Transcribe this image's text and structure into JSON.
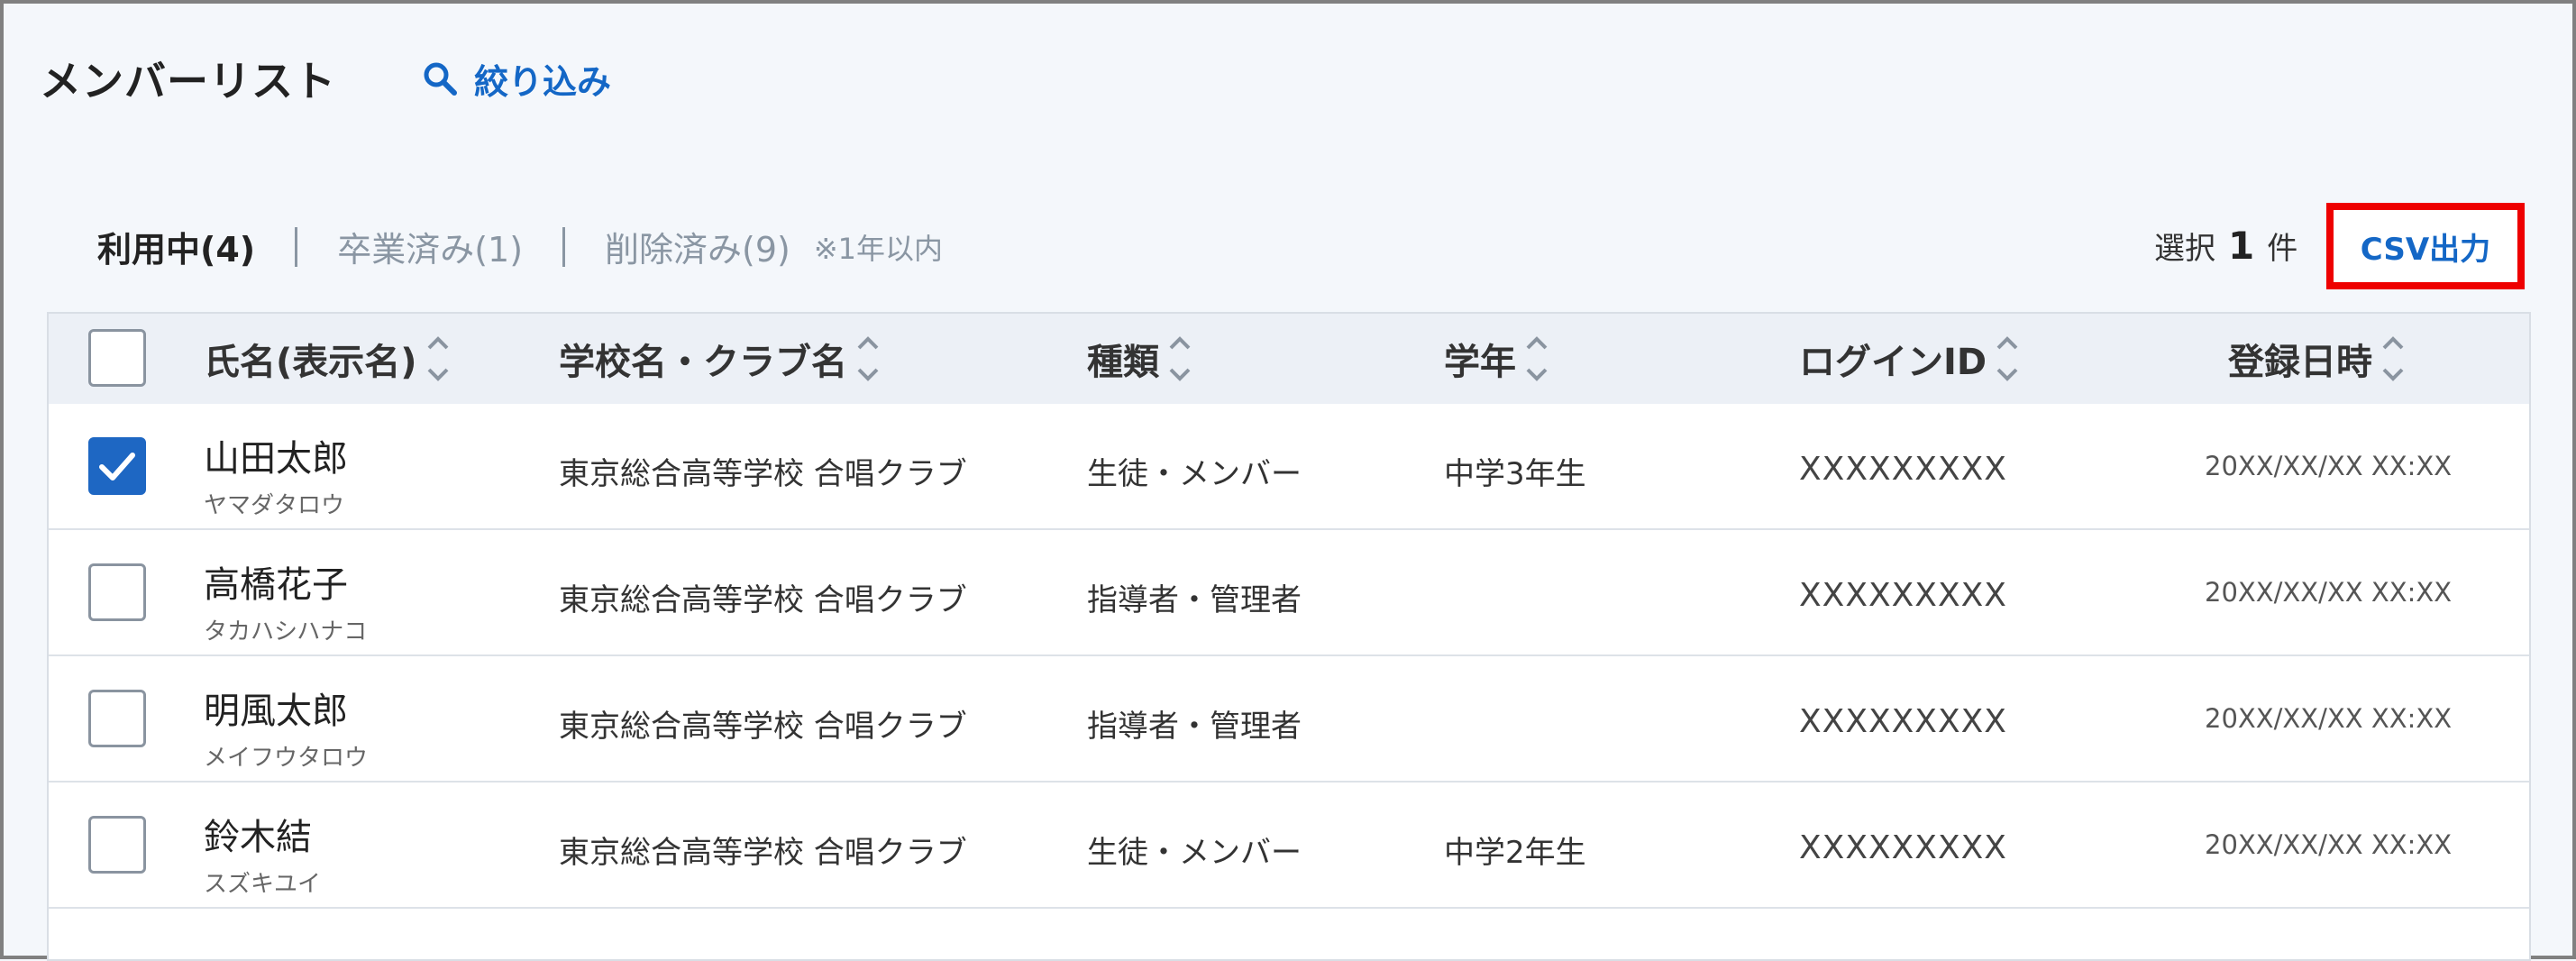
{
  "page": {
    "title": "メンバーリスト",
    "filter_label": "絞り込み"
  },
  "tabs": [
    {
      "label": "利用中(4)",
      "active": true
    },
    {
      "label": "卒業済み(1)",
      "active": false
    },
    {
      "label": "削除済み(9)",
      "active": false
    }
  ],
  "tab_note": "※1年以内",
  "selection": {
    "prefix": "選択",
    "count": "1",
    "suffix": "件"
  },
  "csv_button_label": "CSV出力",
  "table": {
    "columns": [
      "氏名(表示名)",
      "学校名・クラブ名",
      "種類",
      "学年",
      "ログインID",
      "登録日時"
    ],
    "rows": [
      {
        "checked": true,
        "name": "山田太郎",
        "kana": "ヤマダタロウ",
        "school": "東京総合高等学校 合唱クラブ",
        "type": "生徒・メンバー",
        "grade": "中学3年生",
        "login_id": "XXXXXXXXX",
        "registered": "20XX/XX/XX XX:XX"
      },
      {
        "checked": false,
        "name": "高橋花子",
        "kana": "タカハシハナコ",
        "school": "東京総合高等学校 合唱クラブ",
        "type": "指導者・管理者",
        "grade": "",
        "login_id": "XXXXXXXXX",
        "registered": "20XX/XX/XX XX:XX"
      },
      {
        "checked": false,
        "name": "明風太郎",
        "kana": "メイフウタロウ",
        "school": "東京総合高等学校 合唱クラブ",
        "type": "指導者・管理者",
        "grade": "",
        "login_id": "XXXXXXXXX",
        "registered": "20XX/XX/XX XX:XX"
      },
      {
        "checked": false,
        "name": "鈴木結",
        "kana": "スズキユイ",
        "school": "東京総合高等学校 合唱クラブ",
        "type": "生徒・メンバー",
        "grade": "中学2年生",
        "login_id": "XXXXXXXXX",
        "registered": "20XX/XX/XX XX:XX"
      }
    ]
  },
  "colors": {
    "accent": "#1467c6",
    "highlight_border": "#ee0000",
    "checkbox_checked": "#1e67c3"
  }
}
